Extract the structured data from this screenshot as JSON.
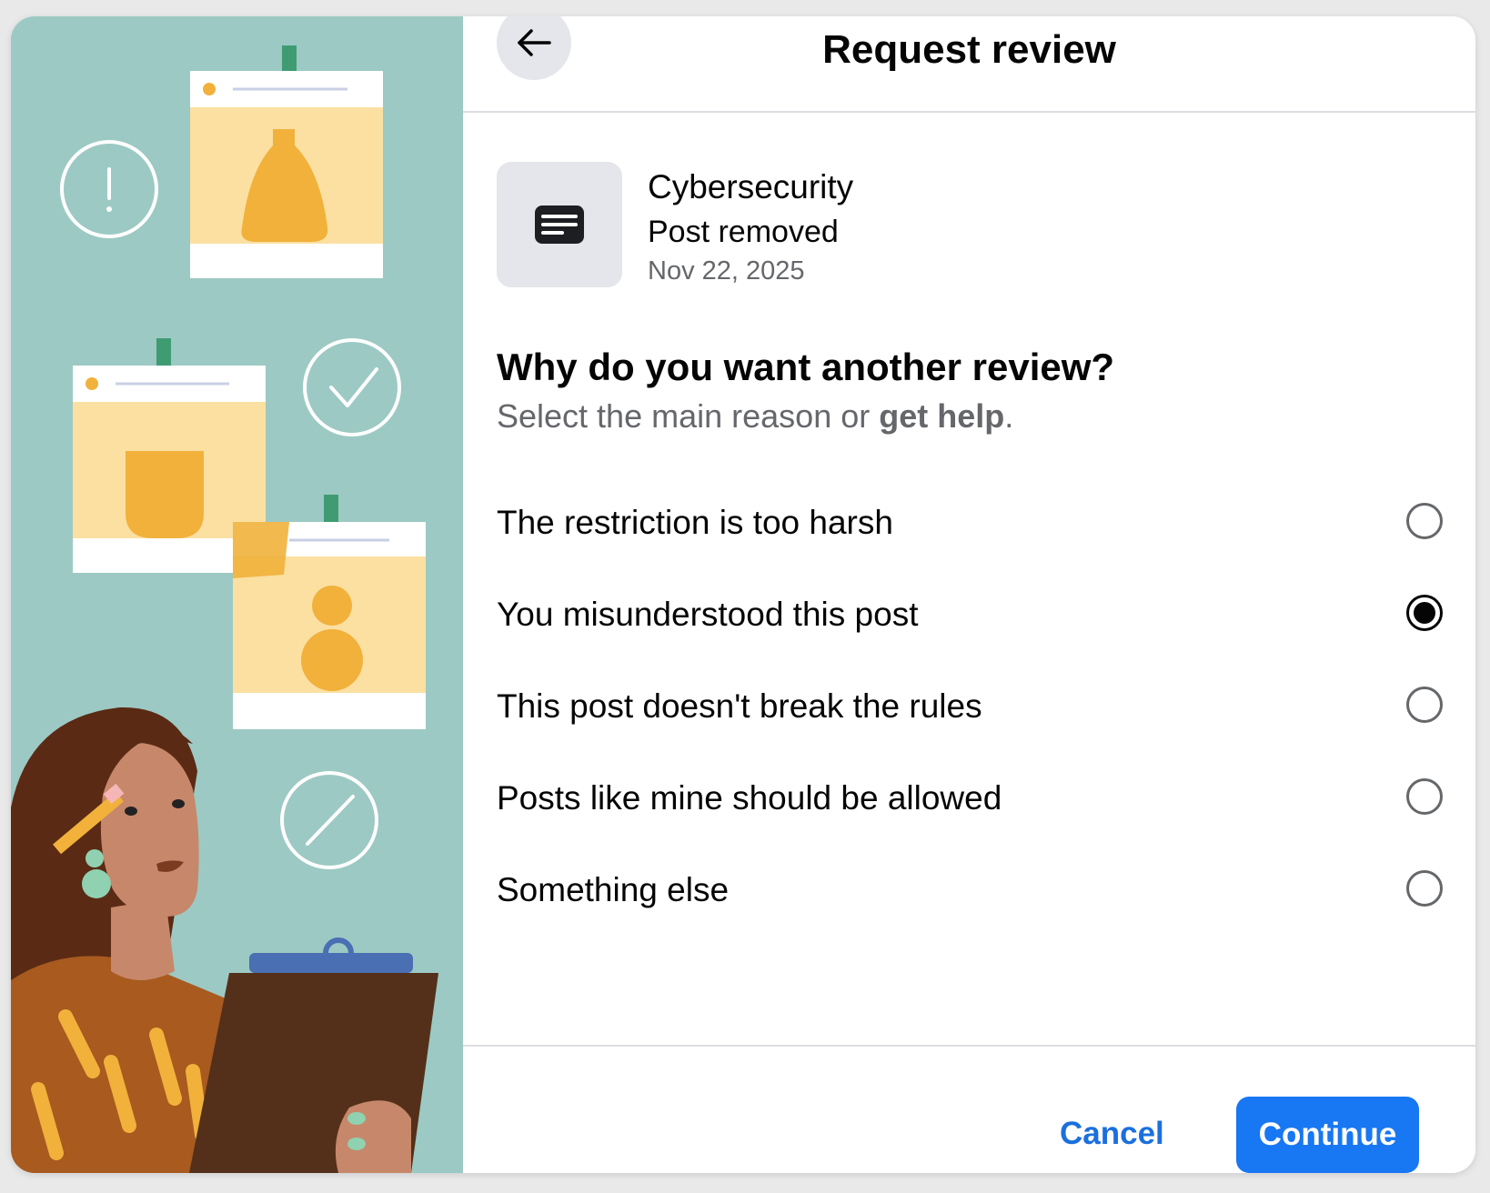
{
  "header": {
    "title": "Request review",
    "back_icon": "arrow-left-icon"
  },
  "post": {
    "icon": "message-lines-icon",
    "group": "Cybersecurity",
    "status": "Post removed",
    "date": "Nov 22, 2025"
  },
  "question": {
    "title": "Why do you want another review?",
    "subtitle_prefix": "Select the main reason or ",
    "subtitle_link": "get help",
    "subtitle_suffix": "."
  },
  "options": [
    {
      "label": "The restriction is too harsh",
      "selected": false
    },
    {
      "label": "You misunderstood this post",
      "selected": true
    },
    {
      "label": "This post doesn't break the rules",
      "selected": false
    },
    {
      "label": "Posts like mine should be allowed",
      "selected": false
    },
    {
      "label": "Something else",
      "selected": false
    }
  ],
  "footer": {
    "cancel_label": "Cancel",
    "continue_label": "Continue"
  },
  "colors": {
    "primary": "#1877f2",
    "illustration_bg": "#9cc9c3",
    "paper_accent": "#f1b13b"
  }
}
